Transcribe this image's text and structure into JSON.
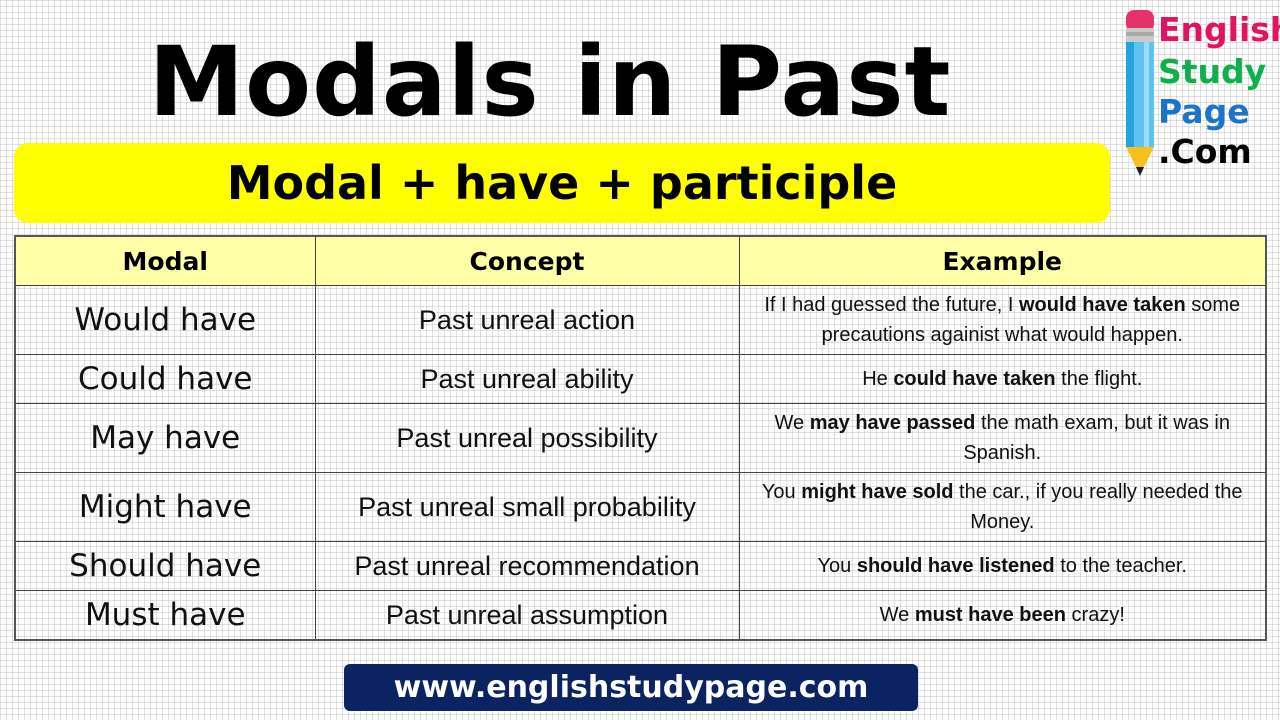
{
  "title": "Modals in Past",
  "formula": "Modal + have + participle",
  "logo": {
    "words": [
      "English",
      "Study",
      "Page",
      ".Com"
    ],
    "colors": [
      "#e0145f",
      "#0db04b",
      "#1c73c8",
      "#000000"
    ],
    "icon": "pencil-icon"
  },
  "table": {
    "headers": [
      "Modal",
      "Concept",
      "Example"
    ],
    "rows": [
      {
        "modal": "Would have",
        "concept": "Past unreal action",
        "example": {
          "pre": "If I had guessed the future, I ",
          "bold": "would have taken",
          "post": " some precautions againist what would happen."
        }
      },
      {
        "modal": "Could have",
        "concept": "Past unreal ability",
        "example": {
          "pre": "He ",
          "bold": "could have taken",
          "post": " the flight."
        }
      },
      {
        "modal": "May have",
        "concept": "Past unreal possibility",
        "example": {
          "pre": "We ",
          "bold": "may have passed",
          "post": " the math exam, but it was in Spanish."
        }
      },
      {
        "modal": "Might have",
        "concept": "Past unreal small probability",
        "example": {
          "pre": "You ",
          "bold": "might have sold",
          "post": " the car., if you really needed the Money."
        }
      },
      {
        "modal": "Should have",
        "concept": "Past unreal recommendation",
        "example": {
          "pre": "You ",
          "bold": "should have listened",
          "post": " to the teacher."
        }
      },
      {
        "modal": "Must have",
        "concept": "Past unreal assumption",
        "example": {
          "pre": "We ",
          "bold": "must have been",
          "post": " crazy!"
        }
      }
    ]
  },
  "footer": {
    "url": "www.englishstudypage.com",
    "bg_color": "#0b2360"
  },
  "accent_color": "#ffff00",
  "header_bg_color": "#ffffa8"
}
